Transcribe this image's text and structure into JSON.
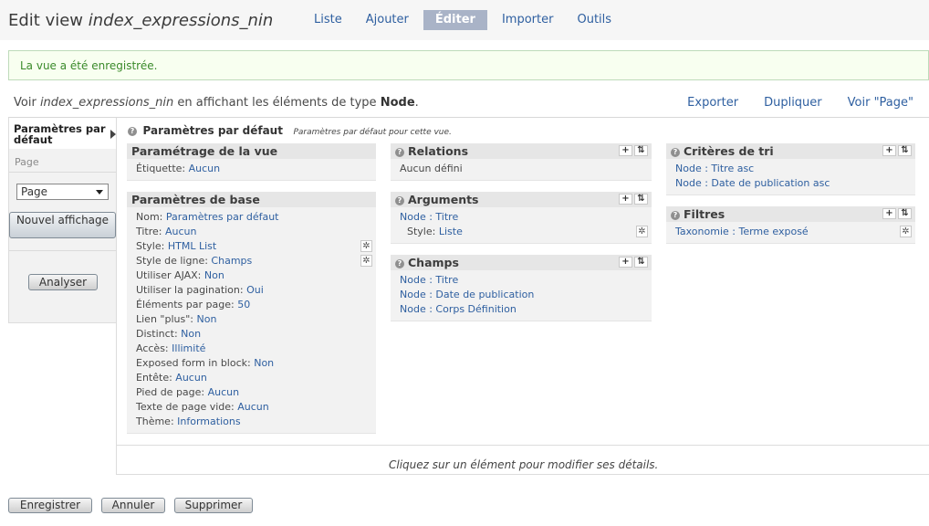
{
  "header": {
    "title_prefix": "Edit view",
    "title_view": "index_expressions_nin",
    "tabs": [
      "Liste",
      "Ajouter",
      "Éditer",
      "Importer",
      "Outils"
    ]
  },
  "message": "La vue a été enregistrée.",
  "viewline": {
    "prefix": "Voir",
    "view_name": "index_expressions_nin",
    "middle": "en affichant les éléments de type",
    "type": "Node",
    "suffix": "."
  },
  "view_links": [
    "Exporter",
    "Dupliquer",
    "Voir \"Page\""
  ],
  "left": {
    "active_display": "Paramètres par défaut",
    "page_label": "Page",
    "select_value": "Page",
    "new_display_button": "Nouvel affichage",
    "analyse_button": "Analyser"
  },
  "main": {
    "title": "Paramètres par défaut",
    "description": "Paramètres par défaut pour cette vue.",
    "footer_hint": "Cliquez sur un élément pour modifier ses détails."
  },
  "sections": {
    "view_settings": {
      "title": "Paramétrage de la vue",
      "rows": [
        {
          "label": "Étiquette:",
          "value": "Aucun"
        }
      ]
    },
    "basic_settings": {
      "title": "Paramètres de base",
      "rows": [
        {
          "label": "Nom:",
          "value": "Paramètres par défaut"
        },
        {
          "label": "Titre:",
          "value": "Aucun"
        },
        {
          "label": "Style:",
          "value": "HTML List"
        },
        {
          "label": "Style de ligne:",
          "value": "Champs"
        },
        {
          "label": "Utiliser AJAX:",
          "value": "Non"
        },
        {
          "label": "Utiliser la pagination:",
          "value": "Oui"
        },
        {
          "label": "Éléments par page:",
          "value": "50"
        },
        {
          "label": "Lien \"plus\":",
          "value": "Non"
        },
        {
          "label": "Distinct:",
          "value": "Non"
        },
        {
          "label": "Accès:",
          "value": "Illimité"
        },
        {
          "label": "Exposed form in block:",
          "value": "Non"
        },
        {
          "label": "Entête:",
          "value": "Aucun"
        },
        {
          "label": "Pied de page:",
          "value": "Aucun"
        },
        {
          "label": "Texte de page vide:",
          "value": "Aucun"
        },
        {
          "label": "Thème:",
          "value": "Informations"
        }
      ]
    },
    "relations": {
      "title": "Relations",
      "rows": [
        "Aucun défini"
      ]
    },
    "arguments": {
      "title": "Arguments",
      "rows": [
        "Node : Titre"
      ],
      "style": {
        "label": "Style:",
        "value": "Liste"
      }
    },
    "fields": {
      "title": "Champs",
      "rows": [
        "Node : Titre",
        "Node : Date de publication",
        "Node : Corps Définition"
      ]
    },
    "sort": {
      "title": "Critères de tri",
      "rows": [
        "Node : Titre asc",
        "Node : Date de publication asc"
      ]
    },
    "filters": {
      "title": "Filtres",
      "rows": [
        "Taxonomie : Terme exposé"
      ]
    }
  },
  "buttons": {
    "save": "Enregistrer",
    "cancel": "Annuler",
    "delete": "Supprimer"
  }
}
